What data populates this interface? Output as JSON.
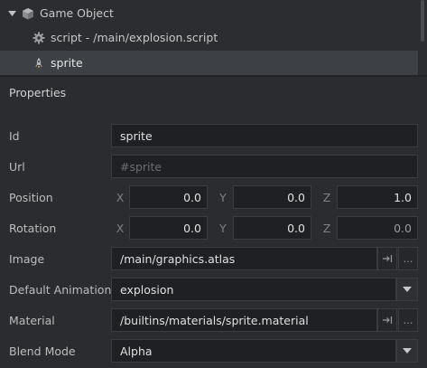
{
  "outline": {
    "items": [
      {
        "label": "Game Object",
        "icon": "game-object-cube-icon",
        "expanded": true
      },
      {
        "label": "script - /main/explosion.script",
        "icon": "gear-icon"
      },
      {
        "label": "sprite",
        "icon": "sprite-rocket-icon",
        "selected": true
      }
    ]
  },
  "properties": {
    "title": "Properties",
    "id": {
      "label": "Id",
      "value": "sprite"
    },
    "url": {
      "label": "Url",
      "placeholder": "#sprite"
    },
    "position": {
      "label": "Position",
      "x_label": "X",
      "x": "0.0",
      "y_label": "Y",
      "y": "0.0",
      "z_label": "Z",
      "z": "1.0"
    },
    "rotation": {
      "label": "Rotation",
      "x_label": "X",
      "x": "0.0",
      "y_label": "Y",
      "y": "0.0",
      "z_label": "Z",
      "z": "0.0"
    },
    "image": {
      "label": "Image",
      "value": "/main/graphics.atlas",
      "goto_glyph": "→|",
      "browse_glyph": "…"
    },
    "default_animation": {
      "label": "Default Animation",
      "value": "explosion"
    },
    "material": {
      "label": "Material",
      "value": "/builtins/materials/sprite.material",
      "goto_glyph": "→|",
      "browse_glyph": "…"
    },
    "blend_mode": {
      "label": "Blend Mode",
      "value": "Alpha"
    }
  },
  "colors": {
    "background": "#2a2c2f",
    "field_bg": "#1f2023",
    "selected_row": "#3d4045"
  }
}
